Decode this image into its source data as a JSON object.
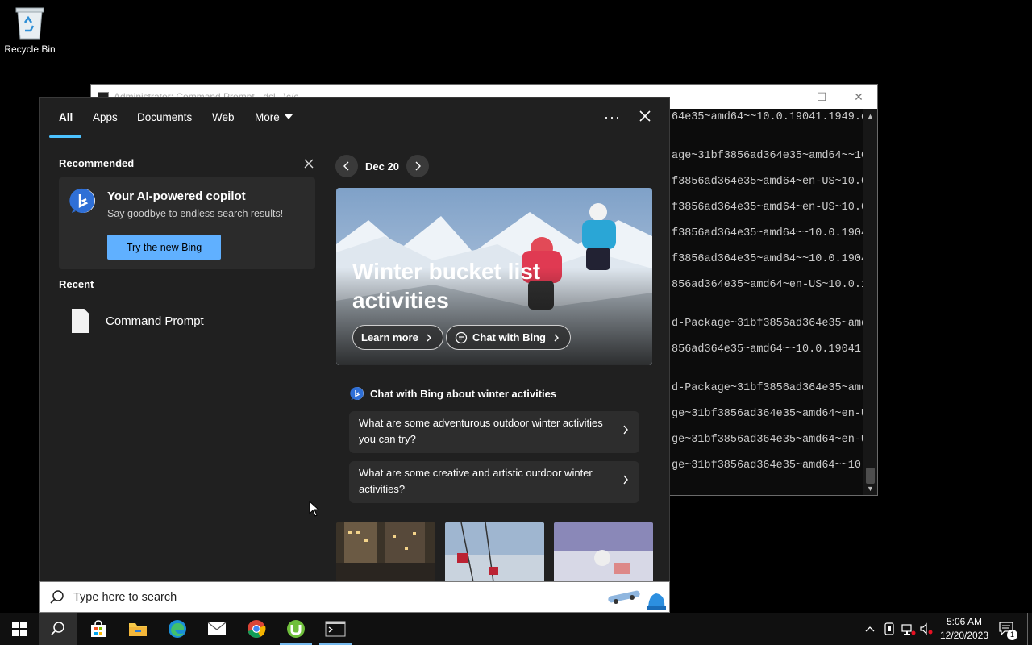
{
  "desktop": {
    "recycle_bin_label": "Recycle Bin"
  },
  "cmd_window": {
    "title": "Administrator: Command Prompt - dsl...\\c/c",
    "lines": [
      "64e35~amd64~~10.0.19041.1949.c",
      "",
      "age~31bf3856ad364e35~amd64~~10",
      "f3856ad364e35~amd64~en-US~10.0",
      "f3856ad364e35~amd64~en-US~10.0",
      "f3856ad364e35~amd64~~10.0.1904",
      "f3856ad364e35~amd64~~10.0.1904",
      "856ad364e35~amd64~en-US~10.0.1",
      "",
      "d-Package~31bf3856ad364e35~amd",
      "856ad364e35~amd64~~10.0.19041.",
      "",
      "d-Package~31bf3856ad364e35~amd",
      "ge~31bf3856ad364e35~amd64~en-U",
      "ge~31bf3856ad364e35~amd64~en-U",
      "ge~31bf3856ad364e35~amd64~~10."
    ]
  },
  "search_panel": {
    "tabs": [
      {
        "label": "All",
        "active": true
      },
      {
        "label": "Apps"
      },
      {
        "label": "Documents"
      },
      {
        "label": "Web"
      },
      {
        "label": "More"
      }
    ],
    "recommended": {
      "heading": "Recommended",
      "card_title": "Your AI-powered copilot",
      "card_subtitle": "Say goodbye to endless search results!",
      "button_label": "Try the new Bing"
    },
    "recent": {
      "heading": "Recent",
      "items": [
        {
          "label": "Command Prompt",
          "icon": "document-icon"
        }
      ]
    },
    "highlights": {
      "date": "Dec 20",
      "hero_title": "Winter bucket list activities",
      "learn_more": "Learn more",
      "chat_with_bing": "Chat with Bing",
      "chat_heading": "Chat with Bing about winter activities",
      "questions": [
        "What are some adventurous outdoor winter activities you can try?",
        "What are some creative and artistic outdoor winter activities?"
      ]
    }
  },
  "searchbox": {
    "placeholder": "Type here to search"
  },
  "taskbar": {
    "apps": [
      "start-icon",
      "search-icon",
      "store-icon",
      "file-explorer-icon",
      "edge-icon",
      "mail-icon",
      "chrome-icon",
      "utorrent-icon",
      "command-prompt-icon"
    ],
    "clock_time": "5:06 AM",
    "clock_date": "12/20/2023",
    "notification_count": "1"
  },
  "colors": {
    "accent": "#4cc2ff",
    "bing_button": "#60b0ff",
    "panel_bg": "#202020"
  }
}
